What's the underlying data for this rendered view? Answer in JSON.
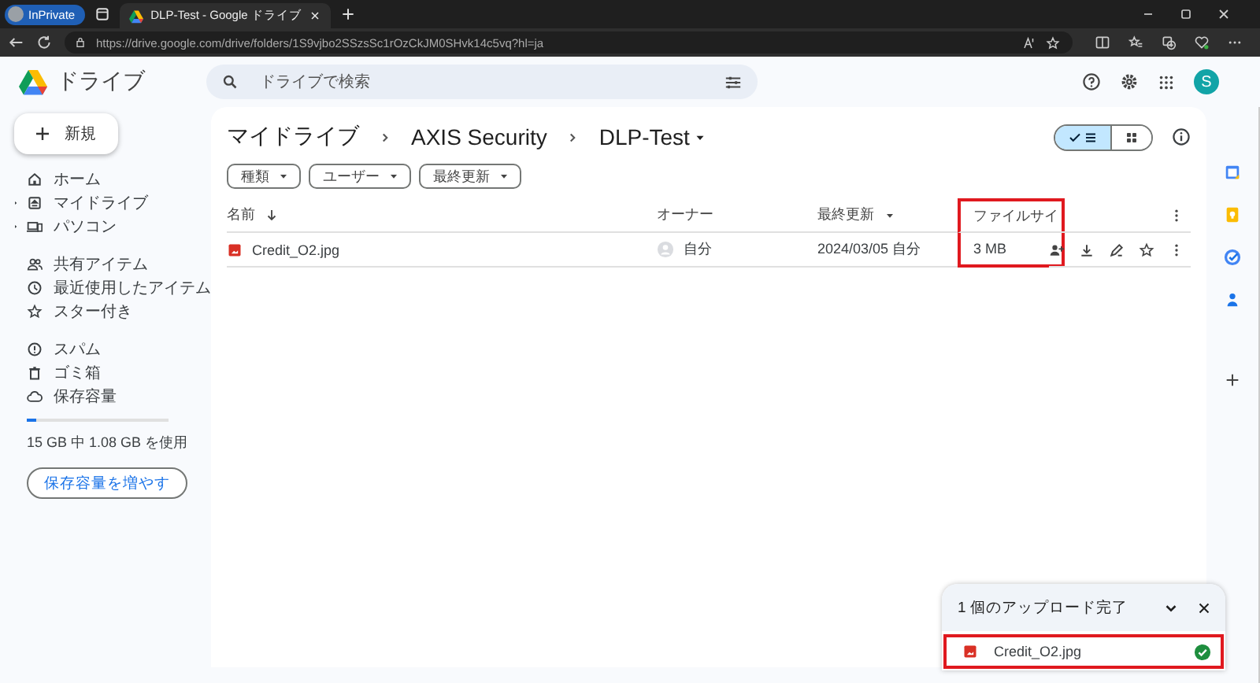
{
  "browser": {
    "private_label": "InPrivate",
    "tab_title": "DLP-Test - Google ドライブ",
    "url": "https://drive.google.com/drive/folders/1S9vjbo2SSzsSc1rOzCkJM0SHvk14c5vq?hl=ja"
  },
  "header": {
    "product": "ドライブ",
    "search": {
      "placeholder": "ドライブで検索"
    },
    "avatar": "S"
  },
  "sidebar": {
    "new_button": "新規",
    "groups": [
      {
        "items": [
          {
            "label": "ホーム",
            "kind": "home",
            "expandable": false
          },
          {
            "label": "マイドライブ",
            "kind": "drive",
            "expandable": true
          },
          {
            "label": "パソコン",
            "kind": "computer",
            "expandable": true
          }
        ]
      },
      {
        "items": [
          {
            "label": "共有アイテム",
            "kind": "shared",
            "expandable": false
          },
          {
            "label": "最近使用したアイテム",
            "kind": "recent",
            "expandable": false
          },
          {
            "label": "スター付き",
            "kind": "star",
            "expandable": false
          }
        ]
      },
      {
        "items": [
          {
            "label": "スパム",
            "kind": "spam",
            "expandable": false
          },
          {
            "label": "ゴミ箱",
            "kind": "trash",
            "expandable": false
          },
          {
            "label": "保存容量",
            "kind": "cloud",
            "expandable": false
          }
        ]
      }
    ],
    "storage": {
      "level": 0.07,
      "text": "15 GB 中 1.08 GB を使用",
      "button": "保存容量を増やす"
    }
  },
  "main": {
    "breadcrumb": [
      {
        "label": "マイドライブ",
        "menu": false
      },
      {
        "label": "AXIS Security",
        "menu": false
      },
      {
        "label": "DLP-Test",
        "menu": true
      }
    ],
    "view_toggle": [
      {
        "kind": "list",
        "selected": true
      },
      {
        "kind": "grid",
        "selected": false
      }
    ],
    "filters": [
      "種類",
      "ユーザー",
      "最終更新"
    ],
    "table": {
      "columns": [
        {
          "label": "名前",
          "sorted": true,
          "menu": false,
          "highlighted": false
        },
        {
          "label": "オーナー",
          "sorted": false,
          "menu": false,
          "highlighted": false
        },
        {
          "label": "最終更新",
          "sorted": false,
          "menu": true,
          "highlighted": false
        },
        {
          "label": "ファイルサイ",
          "sorted": false,
          "menu": false,
          "highlighted": true
        }
      ],
      "rows": [
        {
          "name": "Credit_O2.jpg",
          "owner": "自分",
          "modified": "2024/03/05 自分",
          "size": "3 MB"
        }
      ]
    }
  },
  "upload": {
    "title": "1 個のアップロード完了",
    "items": [
      {
        "name": "Credit_O2.jpg",
        "done": true,
        "highlighted": true
      }
    ]
  }
}
